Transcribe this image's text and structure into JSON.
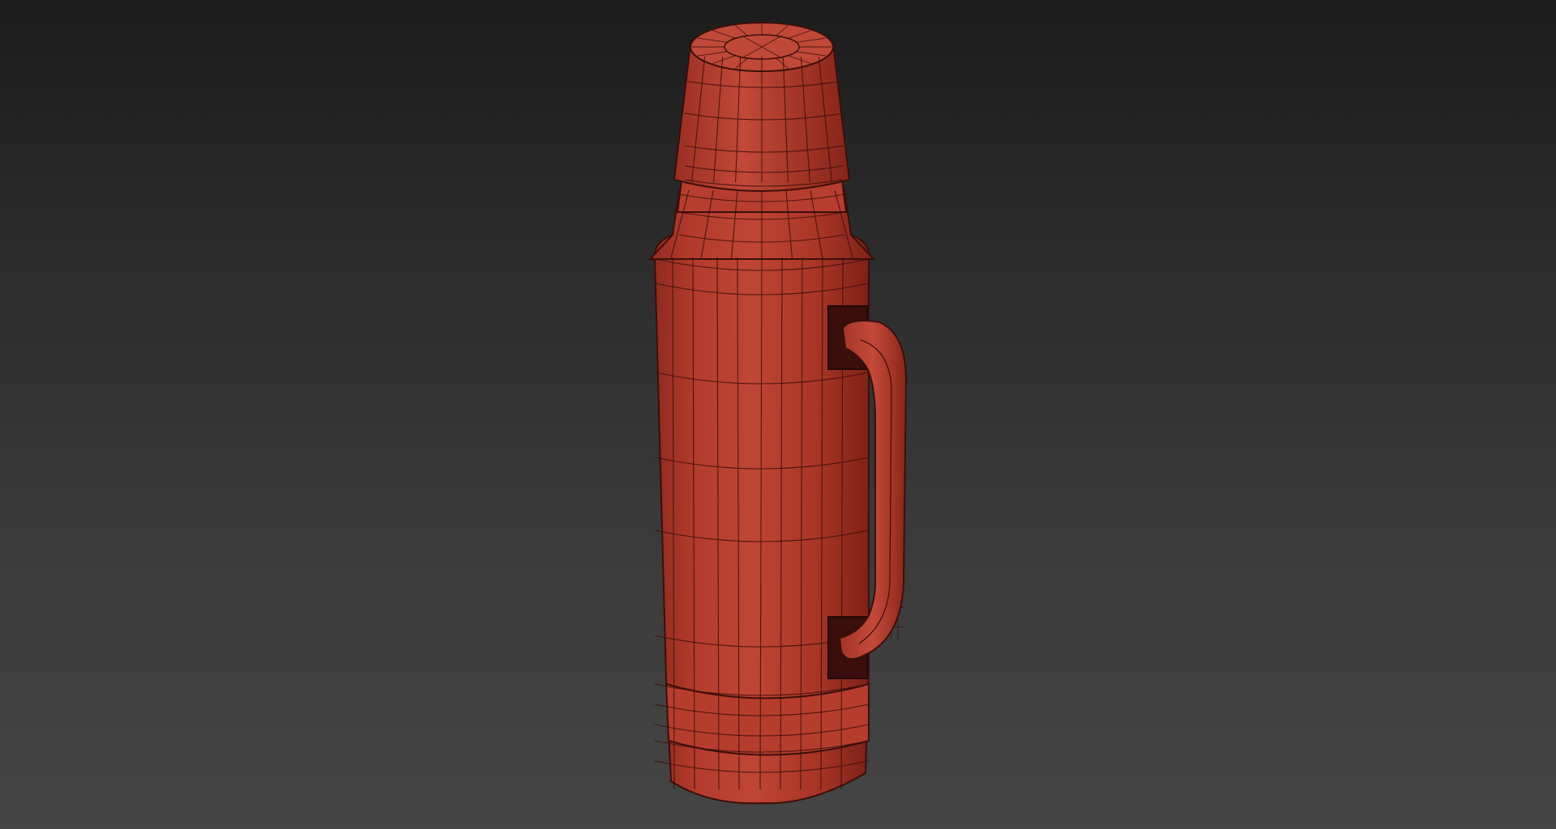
{
  "viewport": {
    "background_top": "#1c1c1c",
    "background_bottom": "#454545"
  },
  "model": {
    "object": "vacuum-flask-thermos",
    "render_style": "wireframe-on-shaded",
    "body_color": "#b3392b",
    "wire_color": "#3a0f0a",
    "handle_recess_color": "#3a0e0c"
  }
}
